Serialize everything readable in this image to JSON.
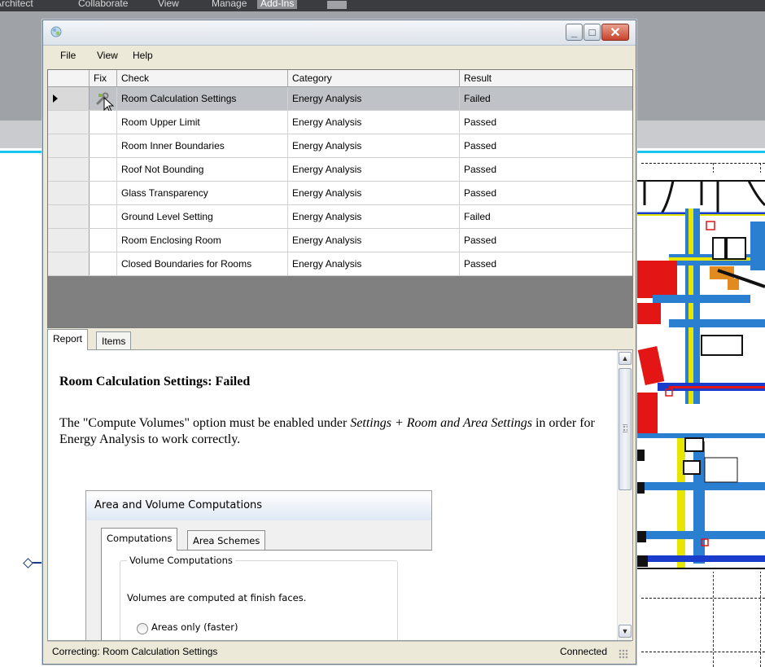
{
  "app": {
    "menus": [
      {
        "label": "Architect"
      },
      {
        "label": "Collaborate"
      },
      {
        "label": "View"
      },
      {
        "label": "Manage"
      },
      {
        "label": "Add-Ins"
      }
    ]
  },
  "window": {
    "menu": [
      "File",
      "View",
      "Help"
    ]
  },
  "grid": {
    "columns": [
      "Fix",
      "Check",
      "Category",
      "Result"
    ],
    "rows": [
      {
        "check": "Room Calculation Settings",
        "category": "Energy Analysis",
        "result": "Failed"
      },
      {
        "check": "Room Upper Limit",
        "category": "Energy Analysis",
        "result": "Passed"
      },
      {
        "check": "Room Inner Boundaries",
        "category": "Energy Analysis",
        "result": "Passed"
      },
      {
        "check": "Roof Not Bounding",
        "category": "Energy Analysis",
        "result": "Passed"
      },
      {
        "check": "Glass Transparency",
        "category": "Energy Analysis",
        "result": "Passed"
      },
      {
        "check": "Ground Level Setting",
        "category": "Energy Analysis",
        "result": "Failed"
      },
      {
        "check": "Room Enclosing Room",
        "category": "Energy Analysis",
        "result": "Passed"
      },
      {
        "check": "Closed Boundaries for Rooms",
        "category": "Energy Analysis",
        "result": "Passed"
      }
    ]
  },
  "tabs": [
    "Report",
    "Items"
  ],
  "report": {
    "heading": "Room Calculation Settings: Failed",
    "para_before": "The \"Compute Volumes\" option must be enabled under ",
    "para_em": "Settings + Room and Area Settings",
    "para_after": " in order for Energy Analysis to work correctly.",
    "embedded": {
      "title": "Area and Volume Computations",
      "tabs": [
        "Computations",
        "Area Schemes"
      ],
      "group_label": "Volume Computations",
      "description": "Volumes are computed at finish faces.",
      "option": "Areas only (faster)"
    }
  },
  "status": {
    "left": "Correcting: Room Calculation Settings",
    "right": "Connected"
  },
  "colors": {
    "selected_row": "#bfc3c7",
    "grid_empty": "#808080",
    "accent_cyan": "#19c4f0"
  }
}
